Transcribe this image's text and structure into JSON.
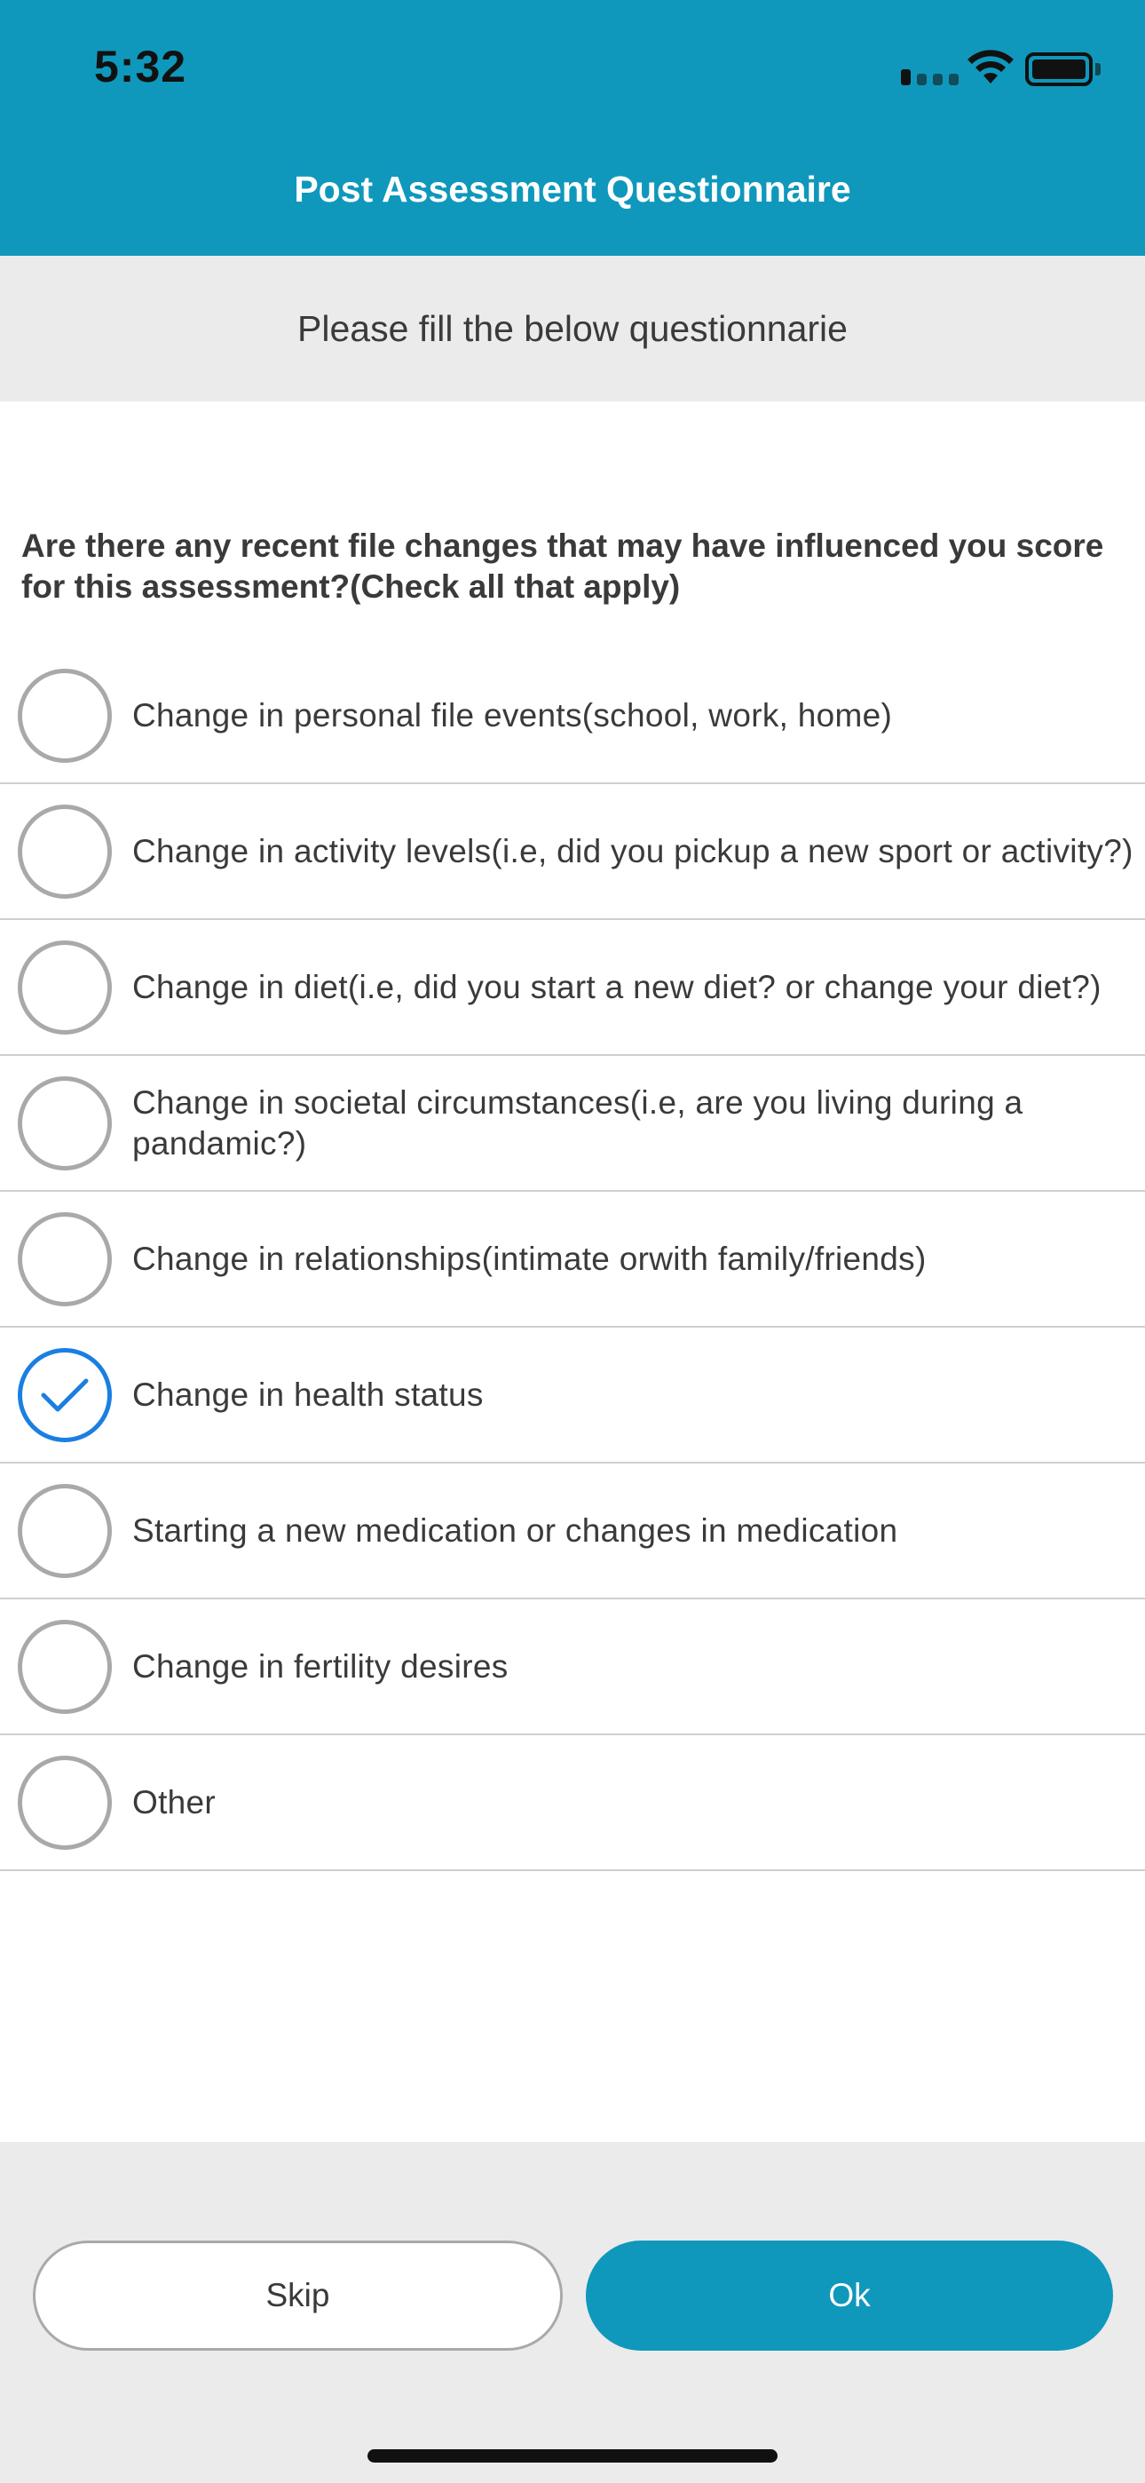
{
  "status_bar": {
    "time": "5:32",
    "icons": [
      "signal-icon",
      "wifi-icon",
      "battery-icon"
    ]
  },
  "header": {
    "title": "Post Assessment Questionnaire"
  },
  "subheader": {
    "text": "Please fill the below questionnarie"
  },
  "question": {
    "text": "Are there any recent file changes that may have influenced you score for this assessment?(Check all that apply)"
  },
  "options": [
    {
      "label": "Change in personal file events(school, work, home)",
      "checked": false
    },
    {
      "label": "Change in activity levels(i.e, did you pickup a new sport or activity?)",
      "checked": false
    },
    {
      "label": "Change in diet(i.e, did you start a new diet? or change your diet?)",
      "checked": false
    },
    {
      "label": "Change in societal circumstances(i.e, are you living during a pandamic?)",
      "checked": false
    },
    {
      "label": "Change in relationships(intimate orwith family/friends)",
      "checked": false
    },
    {
      "label": "Change in health status",
      "checked": true
    },
    {
      "label": "Starting a new medication or changes in medication",
      "checked": false
    },
    {
      "label": "Change in fertility desires",
      "checked": false
    },
    {
      "label": "Other",
      "checked": false
    }
  ],
  "footer": {
    "skip_label": "Skip",
    "ok_label": "Ok"
  },
  "colors": {
    "header_bg": "#0f98bb",
    "check_accent": "#1a7fe0",
    "subheader_bg": "#ebebec"
  }
}
